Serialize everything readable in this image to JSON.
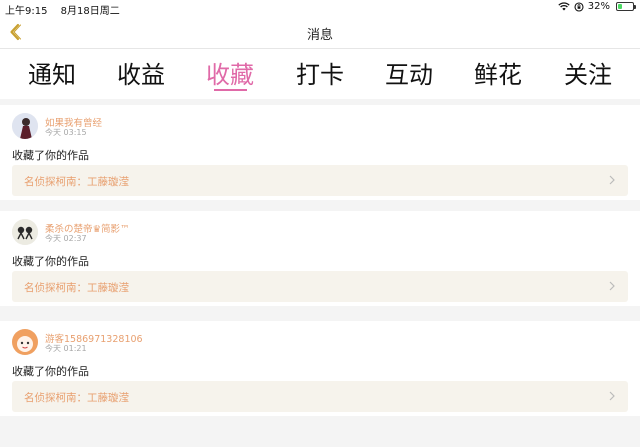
{
  "status_bar": {
    "time": "上午9:15",
    "date": "8月18日周二",
    "battery_pct": "32%",
    "battery_level": 0.32
  },
  "nav": {
    "title": "消息",
    "back_icon": "chevron-left-icon",
    "accent_color": "#c8a030"
  },
  "tabs": [
    {
      "label": "通知"
    },
    {
      "label": "收益"
    },
    {
      "label": "收藏"
    },
    {
      "label": "打卡"
    },
    {
      "label": "互动"
    },
    {
      "label": "鲜花"
    },
    {
      "label": "关注"
    }
  ],
  "active_tab": "收藏",
  "colors": {
    "active_tab": "#e06aa8",
    "username": "#e8a070",
    "work_title": "#e8a070",
    "work_box_bg": "#f6f3ec"
  },
  "messages": [
    {
      "username": "如果我有曾经",
      "time": "今天 03:15",
      "action": "收藏了你的作品",
      "work_title": "名侦探柯南：工藤璇滢"
    },
    {
      "username": "柔杀の楚帝♛简影™",
      "time": "今天 02:37",
      "action": "收藏了你的作品",
      "work_title": "名侦探柯南：工藤璇滢"
    },
    {
      "username": "游客1586971328106",
      "time": "今天 01:21",
      "action": "收藏了你的作品",
      "work_title": "名侦探柯南：工藤璇滢"
    }
  ]
}
